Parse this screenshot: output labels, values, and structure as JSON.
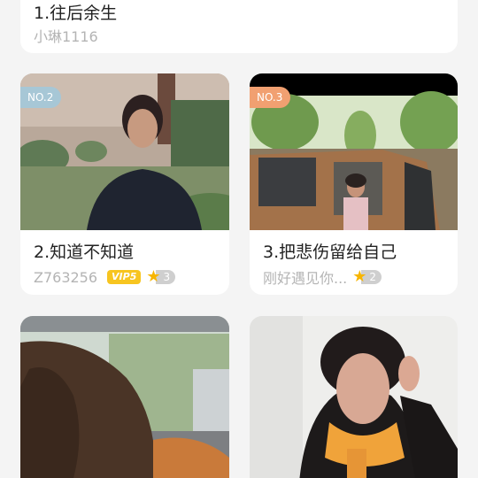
{
  "top_card": {
    "title": "1.往后余生",
    "author": "小琳1116"
  },
  "cards": [
    {
      "rank": "NO.2",
      "title": "2.知道不知道",
      "author": "Z763256",
      "vip": "VIP5",
      "level": "3"
    },
    {
      "rank": "NO.3",
      "title": "3.把悲伤留给自己",
      "author": "刚好遇见你...",
      "level": "2"
    }
  ],
  "colors": {
    "rank2": "#a7c7d6",
    "rank3": "#f1a071",
    "vip": "#f7c520",
    "star": "#f7b500"
  },
  "icons": {
    "level": "star-icon"
  }
}
